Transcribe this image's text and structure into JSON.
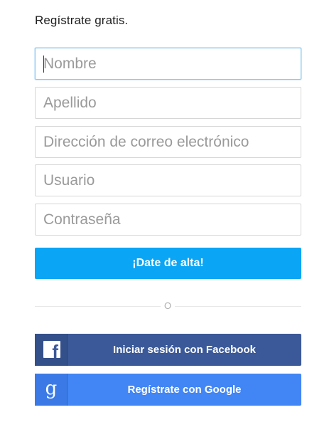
{
  "header": {
    "title": "Regístrate gratis."
  },
  "form": {
    "fields": [
      {
        "name": "first-name",
        "placeholder": "Nombre",
        "value": ""
      },
      {
        "name": "last-name",
        "placeholder": "Apellido",
        "value": ""
      },
      {
        "name": "email",
        "placeholder": "Dirección de correo electrónico",
        "value": ""
      },
      {
        "name": "username",
        "placeholder": "Usuario",
        "value": ""
      },
      {
        "name": "password",
        "placeholder": "Contraseña",
        "value": ""
      }
    ],
    "submit_label": "¡Date de alta!"
  },
  "divider": {
    "label": "O"
  },
  "social": {
    "facebook": {
      "label": "Iniciar sesión con Facebook",
      "icon": "facebook-icon",
      "icon_glyph": "f",
      "color": "#3b5998"
    },
    "google": {
      "label": "Regístrate con Google",
      "icon": "google-icon",
      "icon_glyph": "g",
      "color": "#4285f4"
    }
  },
  "colors": {
    "primary": "#0aa5f5",
    "focus_border": "#8ec9ee"
  }
}
